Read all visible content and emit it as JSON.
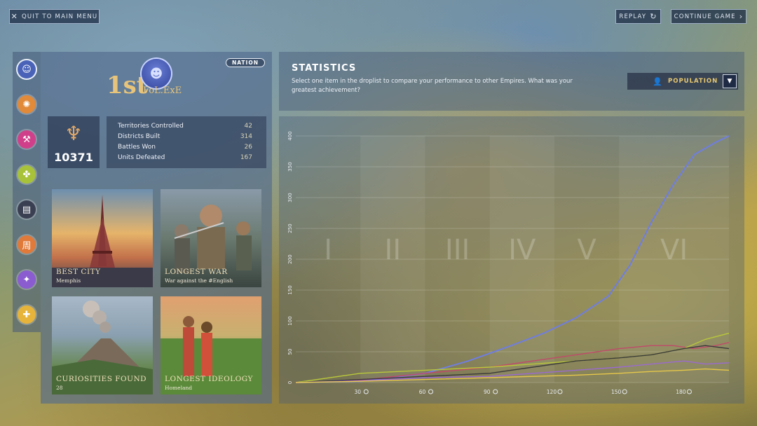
{
  "topbar": {
    "quit_label": "QUIT TO MAIN MENU",
    "replay_label": "REPLAY",
    "continue_label": "CONTINUE GAME"
  },
  "tabs": [
    {
      "name": "nation-tab",
      "color": "#4a63b8"
    },
    {
      "name": "tab-2",
      "color": "#e08a3a"
    },
    {
      "name": "tab-3",
      "color": "#d0408a"
    },
    {
      "name": "tab-4",
      "color": "#a8c23a"
    },
    {
      "name": "tab-5",
      "color": "#3a3f52"
    },
    {
      "name": "tab-6",
      "color": "#e07a3a"
    },
    {
      "name": "tab-7",
      "color": "#8a5cd0"
    },
    {
      "name": "tab-8",
      "color": "#e6b43a"
    }
  ],
  "nation": {
    "badge": "NATION",
    "rank": "1st",
    "player": "FoL.ExE",
    "score": "10371",
    "stats": [
      {
        "label": "Territories Controlled",
        "value": "42"
      },
      {
        "label": "Districts Built",
        "value": "314"
      },
      {
        "label": "Battles Won",
        "value": "26"
      },
      {
        "label": "Units Defeated",
        "value": "167"
      }
    ]
  },
  "achievements": [
    {
      "title": "BEST CITY",
      "subtitle": "Memphis"
    },
    {
      "title": "LONGEST WAR",
      "subtitle": "War against the #English"
    },
    {
      "title": "CURIOSITIES FOUND",
      "subtitle": "28"
    },
    {
      "title": "LONGEST IDEOLOGY",
      "subtitle": "Homeland"
    }
  ],
  "statistics": {
    "title": "STATISTICS",
    "description": "Select one item in the droplist to compare your performance to other Empires. What was your greatest achievement?",
    "dropdown_value": "POPULATION"
  },
  "chart_data": {
    "type": "line",
    "x_ticks": [
      30,
      60,
      90,
      120,
      150,
      180
    ],
    "y_ticks": [
      0,
      50,
      100,
      150,
      200,
      250,
      300,
      350,
      400
    ],
    "xlim": [
      0,
      201
    ],
    "ylim": [
      0,
      400
    ],
    "eras": [
      "I",
      "II",
      "III",
      "IV",
      "V",
      "VI"
    ],
    "series": [
      {
        "color": "#6f7ee0",
        "x": [
          0,
          30,
          60,
          80,
          100,
          115,
          130,
          145,
          155,
          165,
          175,
          185,
          195,
          201
        ],
        "y": [
          0,
          2,
          15,
          35,
          60,
          80,
          105,
          140,
          190,
          260,
          320,
          370,
          390,
          400
        ]
      },
      {
        "color": "#c04a6a",
        "x": [
          0,
          30,
          60,
          90,
          110,
          130,
          150,
          165,
          175,
          185,
          195,
          201
        ],
        "y": [
          0,
          4,
          15,
          25,
          35,
          45,
          55,
          60,
          60,
          55,
          60,
          65
        ]
      },
      {
        "color": "#b8c83a",
        "x": [
          0,
          30,
          60,
          90,
          110,
          130,
          150,
          165,
          180,
          190,
          201
        ],
        "y": [
          0,
          15,
          20,
          25,
          30,
          35,
          40,
          45,
          55,
          70,
          80
        ]
      },
      {
        "color": "#3a3a3a",
        "x": [
          0,
          30,
          60,
          90,
          110,
          130,
          150,
          165,
          180,
          190,
          201
        ],
        "y": [
          0,
          5,
          10,
          15,
          25,
          35,
          40,
          45,
          55,
          60,
          55
        ]
      },
      {
        "color": "#9a6ad0",
        "x": [
          0,
          30,
          60,
          90,
          110,
          130,
          150,
          165,
          180,
          190,
          201
        ],
        "y": [
          0,
          3,
          8,
          10,
          15,
          20,
          25,
          30,
          35,
          30,
          32
        ]
      },
      {
        "color": "#e6c84a",
        "x": [
          0,
          30,
          60,
          90,
          110,
          130,
          150,
          165,
          180,
          190,
          201
        ],
        "y": [
          0,
          2,
          5,
          8,
          10,
          12,
          15,
          18,
          20,
          22,
          20
        ]
      }
    ]
  }
}
